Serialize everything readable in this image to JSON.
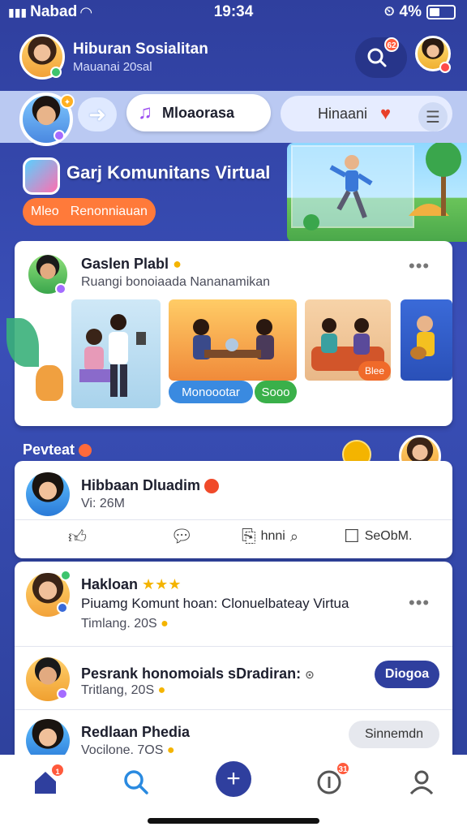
{
  "status": {
    "carrier": "Nabad",
    "time": "19:34",
    "battery": "4%"
  },
  "header": {
    "title": "Hiburan Sosialitan",
    "subtitle": "Mauanai 20sal",
    "notif_badge": "62"
  },
  "pills": {
    "music_label": "Mloaorasa",
    "hibuan_label": "Hinaani"
  },
  "banner": {
    "title": "Garj Komunitans Virtual",
    "btn_left": "Mleo",
    "btn_right": "Renonniauan"
  },
  "feature_post": {
    "author": "Gaslen Plabl",
    "desc": "Ruangi bonoiaada Nananamikan",
    "chip_blue": "Monoootar",
    "chip_green": "Sooo",
    "tag_orange": "Blee"
  },
  "section": {
    "label": "Pevteat"
  },
  "post": {
    "author": "Hibbaan Dluadim",
    "time": "Vi: 26M",
    "actions": [
      {
        "icon": "like-icon",
        "label": ""
      },
      {
        "icon": "comment-icon",
        "label": ""
      },
      {
        "icon": "share-icon",
        "label": "hnni"
      },
      {
        "icon": "save-icon",
        "label": "SeObM."
      }
    ]
  },
  "list": [
    {
      "name": "Hakloan",
      "desc": "Piuamg Komunt hoan: Clonuelbateay Virtua",
      "date": "Timlang. 20S",
      "button": ""
    },
    {
      "name": "Pesrank honomoials sDradiran:",
      "desc": "",
      "date": "Tritlang, 20S",
      "button": "Diogoa"
    },
    {
      "name": "Redlaan Phedia",
      "desc": "",
      "date": "Vocilone. 7OS",
      "button": "Sinnemdn"
    }
  ],
  "nav": {
    "messages_badge": "31"
  }
}
